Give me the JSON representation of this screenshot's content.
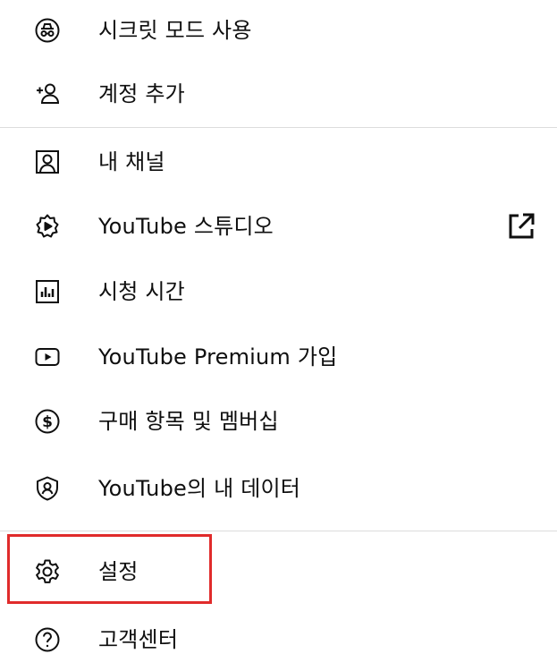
{
  "menu": {
    "items": [
      {
        "label": "시크릿 모드 사용",
        "icon": "incognito-icon"
      },
      {
        "label": "계정 추가",
        "icon": "add-account-icon"
      },
      {
        "label": "내 채널",
        "icon": "channel-icon"
      },
      {
        "label": "YouTube 스튜디오",
        "icon": "studio-icon"
      },
      {
        "label": "시청 시간",
        "icon": "watch-time-icon"
      },
      {
        "label": "YouTube Premium 가입",
        "icon": "youtube-premium-icon"
      },
      {
        "label": "구매 항목 및 멤버십",
        "icon": "purchases-icon"
      },
      {
        "label": "YouTube의 내 데이터",
        "icon": "your-data-shield-icon"
      },
      {
        "label": "설정",
        "icon": "gear-icon"
      },
      {
        "label": "고객센터",
        "icon": "help-icon"
      }
    ],
    "studio_external_icon": "open-external-icon"
  },
  "colors": {
    "icon": "#0f0f0f",
    "divider": "#dcdcdc",
    "highlight_box": "#e02b2b"
  }
}
